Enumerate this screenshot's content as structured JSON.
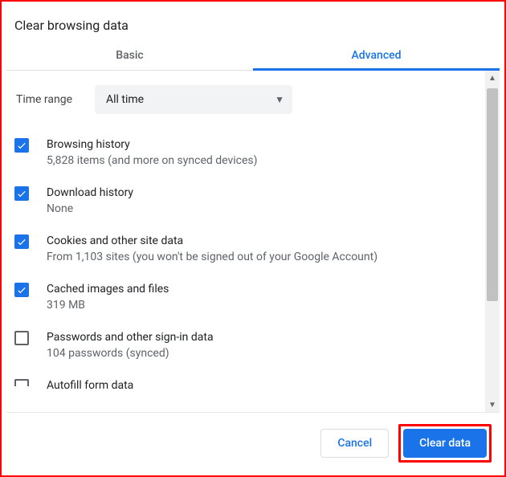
{
  "dialog": {
    "title": "Clear browsing data",
    "tabs": {
      "basic": "Basic",
      "advanced": "Advanced"
    },
    "active_tab": "advanced",
    "time_range": {
      "label": "Time range",
      "value": "All time"
    },
    "items": [
      {
        "title": "Browsing history",
        "sub": "5,828 items (and more on synced devices)",
        "checked": true
      },
      {
        "title": "Download history",
        "sub": "None",
        "checked": true
      },
      {
        "title": "Cookies and other site data",
        "sub": "From 1,103 sites (you won't be signed out of your Google Account)",
        "checked": true
      },
      {
        "title": "Cached images and files",
        "sub": "319 MB",
        "checked": true
      },
      {
        "title": "Passwords and other sign-in data",
        "sub": "104 passwords (synced)",
        "checked": false
      },
      {
        "title": "Autofill form data",
        "sub": "",
        "checked": false
      }
    ],
    "buttons": {
      "cancel": "Cancel",
      "clear": "Clear data"
    }
  }
}
